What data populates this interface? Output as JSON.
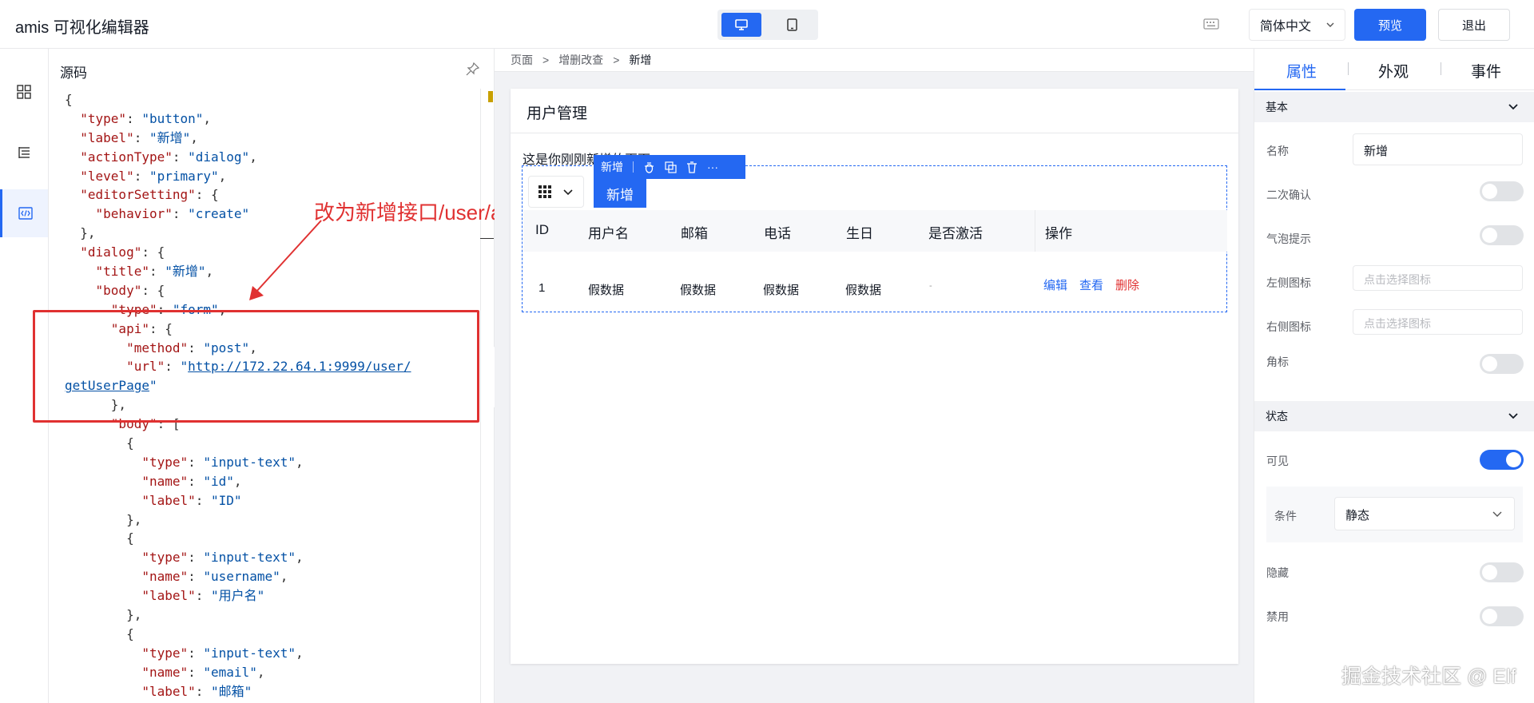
{
  "header": {
    "app_title": "amis 可视化编辑器",
    "language": "简体中文",
    "preview_label": "预览",
    "exit_label": "退出",
    "devices": [
      "desktop-icon",
      "tablet-icon"
    ]
  },
  "rail": {
    "items": [
      "component-grid-icon",
      "outline-tree-icon",
      "code-icon"
    ],
    "active": "code-icon"
  },
  "code_panel": {
    "title": "源码",
    "lines": [
      [
        [
          "p",
          "{"
        ]
      ],
      [
        [
          "p",
          "  "
        ],
        [
          "k",
          "\"type\""
        ],
        [
          "p",
          ": "
        ],
        [
          "s",
          "\"button\""
        ],
        [
          "p",
          ","
        ]
      ],
      [
        [
          "p",
          "  "
        ],
        [
          "k",
          "\"label\""
        ],
        [
          "p",
          ": "
        ],
        [
          "s",
          "\"新增\""
        ],
        [
          "p",
          ","
        ]
      ],
      [
        [
          "p",
          "  "
        ],
        [
          "k",
          "\"actionType\""
        ],
        [
          "p",
          ": "
        ],
        [
          "s",
          "\"dialog\""
        ],
        [
          "p",
          ","
        ]
      ],
      [
        [
          "p",
          "  "
        ],
        [
          "k",
          "\"level\""
        ],
        [
          "p",
          ": "
        ],
        [
          "s",
          "\"primary\""
        ],
        [
          "p",
          ","
        ]
      ],
      [
        [
          "p",
          "  "
        ],
        [
          "k",
          "\"editorSetting\""
        ],
        [
          "p",
          ": {"
        ]
      ],
      [
        [
          "p",
          "    "
        ],
        [
          "k",
          "\"behavior\""
        ],
        [
          "p",
          ": "
        ],
        [
          "s",
          "\"create\""
        ]
      ],
      [
        [
          "p",
          "  },"
        ]
      ],
      [
        [
          "p",
          "  "
        ],
        [
          "k",
          "\"dialog\""
        ],
        [
          "p",
          ": {"
        ]
      ],
      [
        [
          "p",
          "    "
        ],
        [
          "k",
          "\"title\""
        ],
        [
          "p",
          ": "
        ],
        [
          "s",
          "\"新增\""
        ],
        [
          "p",
          ","
        ]
      ],
      [
        [
          "p",
          "    "
        ],
        [
          "k",
          "\"body\""
        ],
        [
          "p",
          ": {"
        ]
      ],
      [
        [
          "p",
          "      "
        ],
        [
          "k",
          "\"type\""
        ],
        [
          "p",
          ": "
        ],
        [
          "s",
          "\"form\""
        ],
        [
          "p",
          ","
        ]
      ],
      [
        [
          "p",
          "      "
        ],
        [
          "k",
          "\"api\""
        ],
        [
          "p",
          ": {"
        ]
      ],
      [
        [
          "p",
          "        "
        ],
        [
          "k",
          "\"method\""
        ],
        [
          "p",
          ": "
        ],
        [
          "s",
          "\"post\""
        ],
        [
          "p",
          ","
        ]
      ],
      [
        [
          "p",
          "        "
        ],
        [
          "k",
          "\"url\""
        ],
        [
          "p",
          ": "
        ],
        [
          "s",
          "\""
        ],
        [
          "url",
          "http://172.22.64.1:9999/user/"
        ]
      ],
      [
        [
          "url",
          "getUserPage"
        ],
        [
          "s",
          "\""
        ]
      ],
      [
        [
          "p",
          "      },"
        ]
      ],
      [
        [
          "p",
          "      "
        ],
        [
          "k",
          "\"body\""
        ],
        [
          "p",
          ": ["
        ]
      ],
      [
        [
          "p",
          "        {"
        ]
      ],
      [
        [
          "p",
          "          "
        ],
        [
          "k",
          "\"type\""
        ],
        [
          "p",
          ": "
        ],
        [
          "s",
          "\"input-text\""
        ],
        [
          "p",
          ","
        ]
      ],
      [
        [
          "p",
          "          "
        ],
        [
          "k",
          "\"name\""
        ],
        [
          "p",
          ": "
        ],
        [
          "s",
          "\"id\""
        ],
        [
          "p",
          ","
        ]
      ],
      [
        [
          "p",
          "          "
        ],
        [
          "k",
          "\"label\""
        ],
        [
          "p",
          ": "
        ],
        [
          "s",
          "\"ID\""
        ]
      ],
      [
        [
          "p",
          "        },"
        ]
      ],
      [
        [
          "p",
          "        {"
        ]
      ],
      [
        [
          "p",
          "          "
        ],
        [
          "k",
          "\"type\""
        ],
        [
          "p",
          ": "
        ],
        [
          "s",
          "\"input-text\""
        ],
        [
          "p",
          ","
        ]
      ],
      [
        [
          "p",
          "          "
        ],
        [
          "k",
          "\"name\""
        ],
        [
          "p",
          ": "
        ],
        [
          "s",
          "\"username\""
        ],
        [
          "p",
          ","
        ]
      ],
      [
        [
          "p",
          "          "
        ],
        [
          "k",
          "\"label\""
        ],
        [
          "p",
          ": "
        ],
        [
          "s",
          "\"用户名\""
        ]
      ],
      [
        [
          "p",
          "        },"
        ]
      ],
      [
        [
          "p",
          "        {"
        ]
      ],
      [
        [
          "p",
          "          "
        ],
        [
          "k",
          "\"type\""
        ],
        [
          "p",
          ": "
        ],
        [
          "s",
          "\"input-text\""
        ],
        [
          "p",
          ","
        ]
      ],
      [
        [
          "p",
          "          "
        ],
        [
          "k",
          "\"name\""
        ],
        [
          "p",
          ": "
        ],
        [
          "s",
          "\"email\""
        ],
        [
          "p",
          ","
        ]
      ],
      [
        [
          "p",
          "          "
        ],
        [
          "k",
          "\"label\""
        ],
        [
          "p",
          ": "
        ],
        [
          "s",
          "\"邮箱\""
        ]
      ],
      [
        [
          "p",
          "        }"
        ]
      ]
    ],
    "annotation": "改为新增接口/user/addUser"
  },
  "breadcrumb": [
    "页面",
    "增删改查",
    "新增"
  ],
  "breadcrumb_sep": ">",
  "page": {
    "title": "用户管理",
    "description": "这是你刚刚新增的页面。",
    "selected_component": "新增",
    "add_button": "新增",
    "table": {
      "columns": [
        "ID",
        "用户名",
        "邮箱",
        "电话",
        "生日",
        "是否激活",
        "操作"
      ],
      "row": [
        "1",
        "假数据",
        "假数据",
        "假数据",
        "假数据",
        "-"
      ],
      "actions": [
        "编辑",
        "查看",
        "删除"
      ]
    }
  },
  "props": {
    "tabs": [
      "属性",
      "外观",
      "事件"
    ],
    "sections": {
      "basic": "基本",
      "state": "状态"
    },
    "fields": {
      "name_label": "名称",
      "name_value": "新增",
      "confirm_label": "二次确认",
      "tooltip_label": "气泡提示",
      "left_icon_label": "左侧图标",
      "left_icon_placeholder": "点击选择图标",
      "right_icon_label": "右侧图标",
      "right_icon_placeholder": "点击选择图标",
      "badge_label": "角标",
      "visible_label": "可见",
      "condition_label": "条件",
      "condition_value": "静态",
      "hidden_label": "隐藏",
      "disabled_label": "禁用"
    },
    "toggles": {
      "confirm": false,
      "tooltip": false,
      "badge": false,
      "visible": true,
      "hidden": false,
      "disabled": false
    }
  },
  "watermark": "掘金技术社区 @ Elf",
  "colors": {
    "primary": "#2468f2",
    "danger": "#e03131",
    "json_key": "#a31515",
    "json_string": "#0451a5"
  }
}
